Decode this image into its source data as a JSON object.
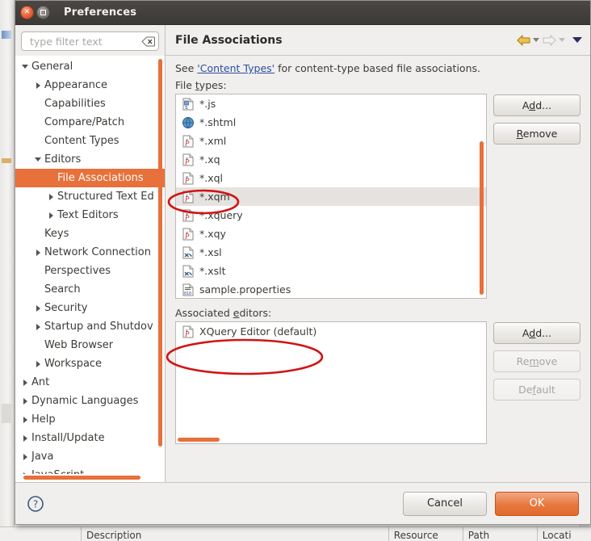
{
  "window": {
    "title": "Preferences",
    "close_label": "x",
    "maximize_label": "maximize"
  },
  "filter": {
    "placeholder": "type filter text",
    "value": "",
    "clear_icon": "clear-text-icon"
  },
  "sidebar": {
    "items": [
      {
        "label": "General",
        "indent": 0,
        "twisty": "down",
        "selected": false
      },
      {
        "label": "Appearance",
        "indent": 1,
        "twisty": "right",
        "selected": false
      },
      {
        "label": "Capabilities",
        "indent": 1,
        "twisty": "none",
        "selected": false
      },
      {
        "label": "Compare/Patch",
        "indent": 1,
        "twisty": "none",
        "selected": false
      },
      {
        "label": "Content Types",
        "indent": 1,
        "twisty": "none",
        "selected": false
      },
      {
        "label": "Editors",
        "indent": 1,
        "twisty": "down",
        "selected": false
      },
      {
        "label": "File Associations",
        "indent": 2,
        "twisty": "none",
        "selected": true
      },
      {
        "label": "Structured Text Ed",
        "indent": 2,
        "twisty": "right",
        "selected": false
      },
      {
        "label": "Text Editors",
        "indent": 2,
        "twisty": "right",
        "selected": false
      },
      {
        "label": "Keys",
        "indent": 1,
        "twisty": "none",
        "selected": false
      },
      {
        "label": "Network Connection",
        "indent": 1,
        "twisty": "right",
        "selected": false
      },
      {
        "label": "Perspectives",
        "indent": 1,
        "twisty": "none",
        "selected": false
      },
      {
        "label": "Search",
        "indent": 1,
        "twisty": "none",
        "selected": false
      },
      {
        "label": "Security",
        "indent": 1,
        "twisty": "right",
        "selected": false
      },
      {
        "label": "Startup and Shutdov",
        "indent": 1,
        "twisty": "right",
        "selected": false
      },
      {
        "label": "Web Browser",
        "indent": 1,
        "twisty": "none",
        "selected": false
      },
      {
        "label": "Workspace",
        "indent": 1,
        "twisty": "right",
        "selected": false
      },
      {
        "label": "Ant",
        "indent": 0,
        "twisty": "right",
        "selected": false
      },
      {
        "label": "Dynamic Languages",
        "indent": 0,
        "twisty": "right",
        "selected": false
      },
      {
        "label": "Help",
        "indent": 0,
        "twisty": "right",
        "selected": false
      },
      {
        "label": "Install/Update",
        "indent": 0,
        "twisty": "right",
        "selected": false
      },
      {
        "label": "Java",
        "indent": 0,
        "twisty": "right",
        "selected": false
      },
      {
        "label": "JavaScript",
        "indent": 0,
        "twisty": "right",
        "selected": false
      }
    ]
  },
  "page": {
    "title": "File Associations",
    "nav": {
      "back_icon": "back-arrow-icon",
      "forward_icon": "forward-arrow-icon",
      "menu_icon": "view-menu-caret-icon"
    },
    "description_prefix": "See ",
    "description_link": "'Content Types'",
    "description_suffix": " for content-type based file associations.",
    "file_types_label": "File types:",
    "associated_editors_label": "Associated editors:",
    "file_types": [
      {
        "name": "*.js",
        "icon": "js-file-icon"
      },
      {
        "name": "*.shtml",
        "icon": "globe-html-file-icon"
      },
      {
        "name": "*.xml",
        "icon": "xquery-file-icon"
      },
      {
        "name": "*.xq",
        "icon": "xquery-file-icon"
      },
      {
        "name": "*.xql",
        "icon": "xquery-file-icon"
      },
      {
        "name": "*.xqm",
        "icon": "xquery-file-icon"
      },
      {
        "name": "*.xquery",
        "icon": "xquery-file-icon"
      },
      {
        "name": "*.xqy",
        "icon": "xquery-file-icon"
      },
      {
        "name": "*.xsl",
        "icon": "xsl-file-icon"
      },
      {
        "name": "*.xslt",
        "icon": "xsl-file-icon"
      },
      {
        "name": "sample.properties",
        "icon": "properties-file-icon"
      }
    ],
    "selected_file_type": "*.xqm",
    "associated_editors": [
      {
        "name": "XQuery Editor (default)",
        "icon": "xquery-file-icon"
      }
    ],
    "filetype_buttons": {
      "add": "Add...",
      "add_mnemonic": "A",
      "remove": "Remove",
      "remove_mnemonic": "R",
      "add_enabled": true,
      "remove_enabled": true
    },
    "editor_buttons": {
      "add": "Add...",
      "add_mnemonic": "d",
      "remove": "Remove",
      "remove_mnemonic": "m",
      "default": "Default",
      "default_mnemonic": "f",
      "add_enabled": true,
      "remove_enabled": false,
      "default_enabled": false
    }
  },
  "footer": {
    "help_icon": "help-question-icon",
    "cancel_label": "Cancel",
    "ok_label": "OK"
  },
  "background": {
    "table_columns": [
      "Description",
      "Resource",
      "Path",
      "Locati"
    ]
  },
  "colors": {
    "accent_orange": "#e8703a",
    "ok_button": "#e8773f",
    "selection_blue_link": "#2a4ea0",
    "titlebar": "#3c3a37",
    "annotation_red": "#d11414"
  }
}
